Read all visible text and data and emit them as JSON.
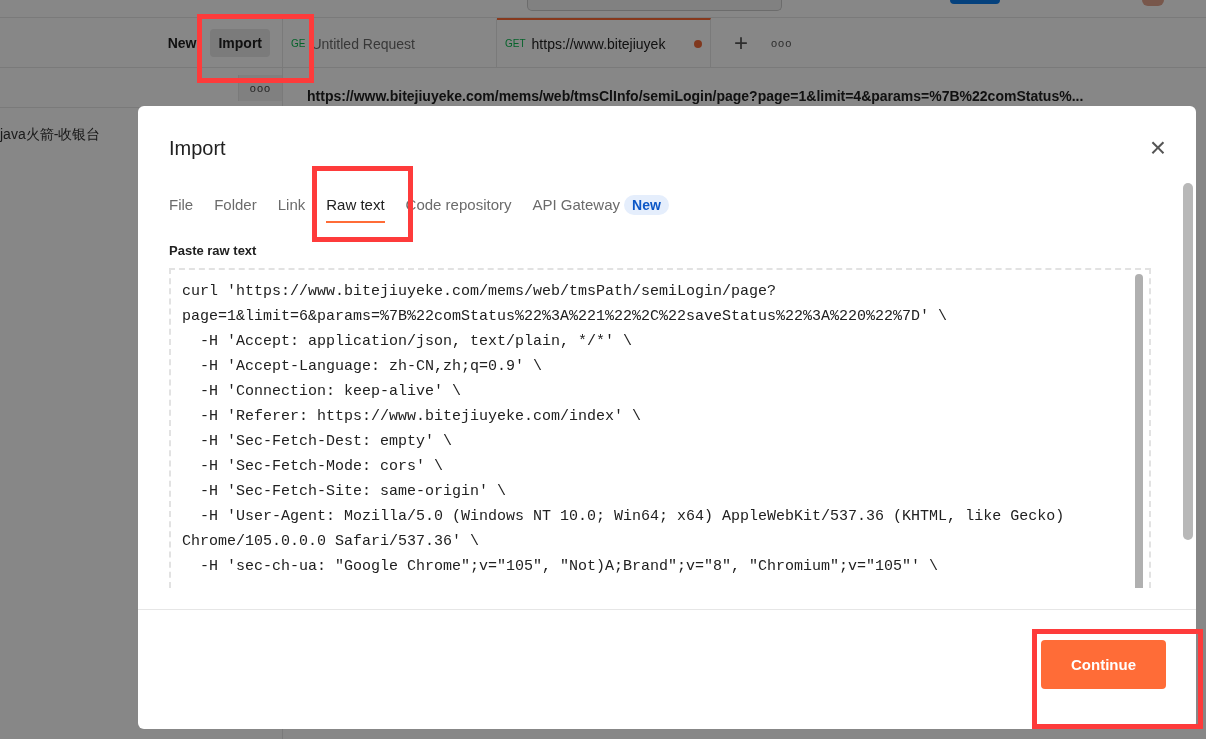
{
  "toolbar": {
    "buttons": [
      {
        "label": "New",
        "selected": false
      },
      {
        "label": "Import",
        "selected": true
      }
    ]
  },
  "request_tabs": [
    {
      "method": "GE",
      "label": "Untitled Request",
      "selected": false,
      "unsaved": false
    },
    {
      "method": "GET",
      "label": "https://www.bitejiuyek",
      "selected": true,
      "unsaved": true
    }
  ],
  "tab_actions": {
    "add": "+",
    "more": "ooo"
  },
  "sidebar": {
    "more": "ooo",
    "items": [
      {
        "label": "java火箭-收银台"
      }
    ]
  },
  "url_bar": {
    "value": "https://www.bitejiuyeke.com/mems/web/tmsClInfo/semiLogin/page?page=1&limit=4&params=%7B%22comStatus%..."
  },
  "dialog": {
    "title": "Import",
    "close": "×",
    "tabs": [
      {
        "label": "File",
        "selected": false
      },
      {
        "label": "Folder",
        "selected": false
      },
      {
        "label": "Link",
        "selected": false
      },
      {
        "label": "Raw text",
        "selected": true
      },
      {
        "label": "Code repository",
        "selected": false
      },
      {
        "label": "API Gateway",
        "selected": false,
        "badge": "New"
      }
    ],
    "field_label": "Paste raw text",
    "raw_text_lines": [
      "curl 'https://www.bitejiuyeke.com/mems/web/tmsPath/semiLogin/page?",
      "page=1&limit=6&params=%7B%22comStatus%22%3A%221%22%2C%22saveStatus%22%3A%220%22%7D' \\",
      "  -H 'Accept: application/json, text/plain, */*' \\",
      "  -H 'Accept-Language: zh-CN,zh;q=0.9' \\",
      "  -H 'Connection: keep-alive' \\",
      "  -H 'Referer: https://www.bitejiuyeke.com/index' \\",
      "  -H 'Sec-Fetch-Dest: empty' \\",
      "  -H 'Sec-Fetch-Mode: cors' \\",
      "  -H 'Sec-Fetch-Site: same-origin' \\",
      "  -H 'User-Agent: Mozilla/5.0 (Windows NT 10.0; Win64; x64) AppleWebKit/537.36 (KHTML, like Gecko)",
      "Chrome/105.0.0.0 Safari/537.36' \\",
      "  -H 'sec-ch-ua: \"Google Chrome\";v=\"105\", \"Not)A;Brand\";v=\"8\", \"Chromium\";v=\"105\"' \\"
    ],
    "primary_button": "Continue"
  }
}
